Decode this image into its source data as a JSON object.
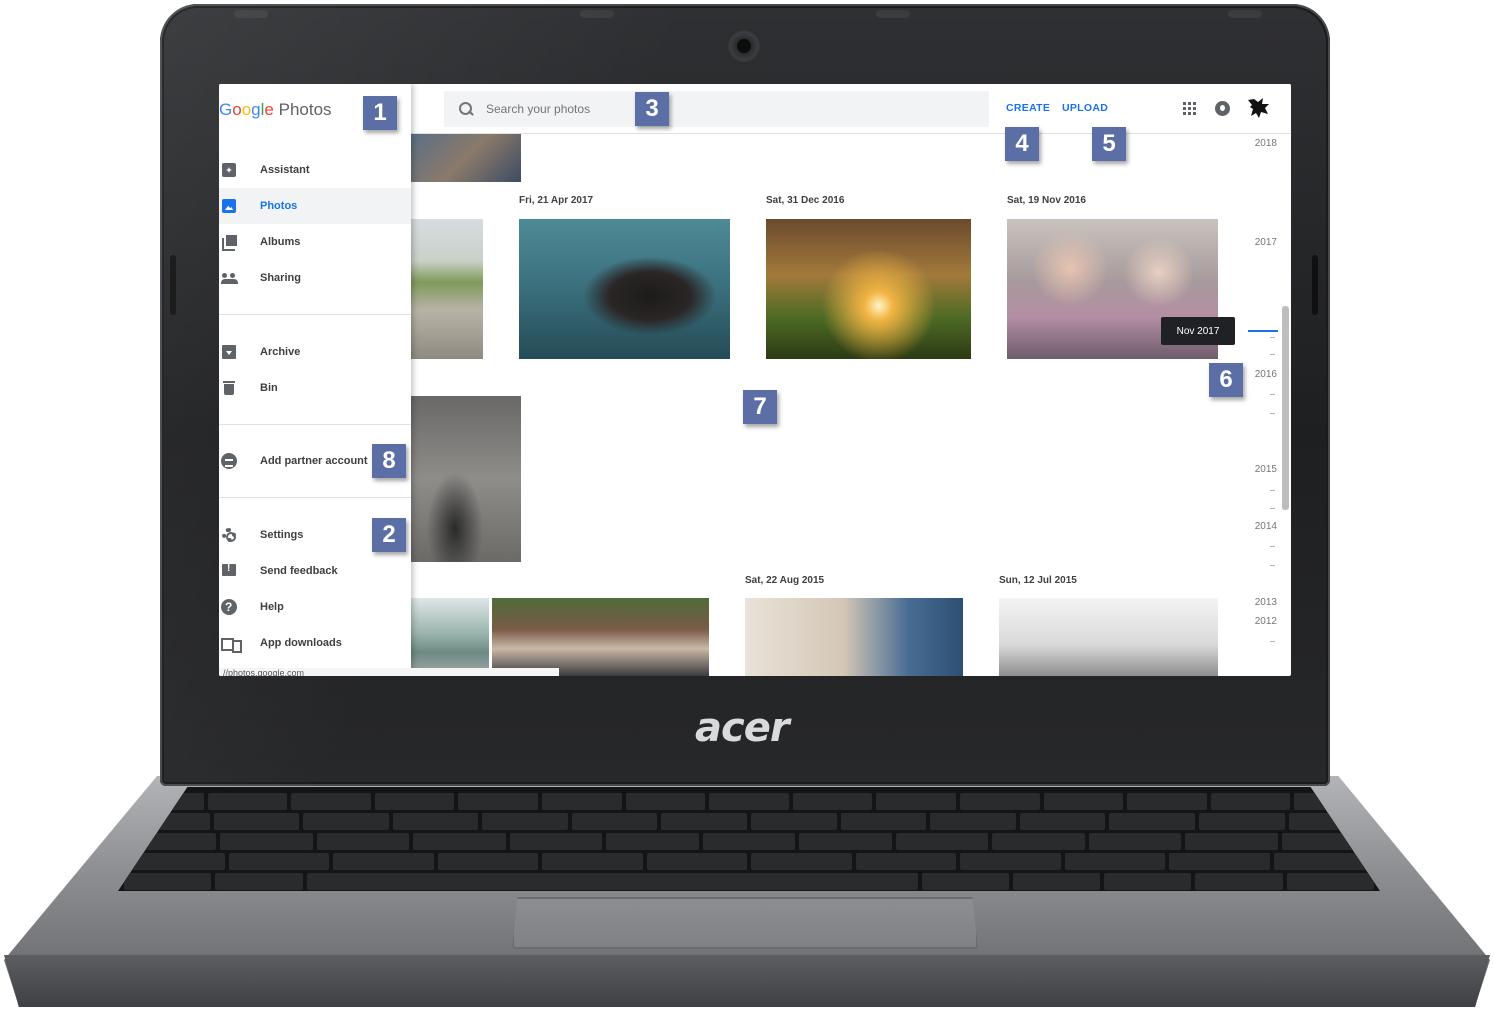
{
  "device": {
    "brand": "acer"
  },
  "app": {
    "logo": {
      "google": [
        "G",
        "o",
        "o",
        "g",
        "l",
        "e"
      ],
      "product": "Photos"
    },
    "url": "//photos.google.com"
  },
  "search": {
    "placeholder": "Search your photos"
  },
  "toolbar": {
    "create_label": "CREATE",
    "upload_label": "UPLOAD",
    "apps_icon": "apps-grid-icon",
    "notifications_icon": "notifications-icon",
    "avatar_icon": "cat-avatar-icon"
  },
  "sidebar": {
    "primary": [
      {
        "label": "Assistant",
        "icon": "assistant-icon",
        "active": false
      },
      {
        "label": "Photos",
        "icon": "photo-icon",
        "active": true
      },
      {
        "label": "Albums",
        "icon": "albums-icon",
        "active": false
      },
      {
        "label": "Sharing",
        "icon": "people-icon",
        "active": false
      }
    ],
    "secondary": [
      {
        "label": "Archive",
        "icon": "archive-icon"
      },
      {
        "label": "Bin",
        "icon": "trash-icon"
      }
    ],
    "partner": {
      "label": "Add partner account",
      "icon": "partner-icon"
    },
    "footer": [
      {
        "label": "Settings",
        "icon": "gear-icon"
      },
      {
        "label": "Send feedback",
        "icon": "feedback-icon"
      },
      {
        "label": "Help",
        "icon": "help-icon"
      },
      {
        "label": "App downloads",
        "icon": "devices-icon"
      }
    ]
  },
  "photo_groups": [
    {
      "date": "Fri, 21 Apr 2017"
    },
    {
      "date": "Sat, 31 Dec 2016"
    },
    {
      "date": "Sat, 19 Nov 2016"
    },
    {
      "date": "Sat, 22 Aug 2015"
    },
    {
      "date": "Sun, 12 Jul 2015"
    }
  ],
  "timeline": {
    "years": [
      "2018",
      "2017",
      "2016",
      "2015",
      "2014",
      "2013",
      "2012"
    ],
    "tooltip": "Nov 2017"
  },
  "callouts": [
    "1",
    "2",
    "3",
    "4",
    "5",
    "6",
    "7",
    "8"
  ],
  "colors": {
    "accent": "#1a73e8",
    "callout": "#5b6fa6",
    "active_bg": "#f1f3f4"
  }
}
